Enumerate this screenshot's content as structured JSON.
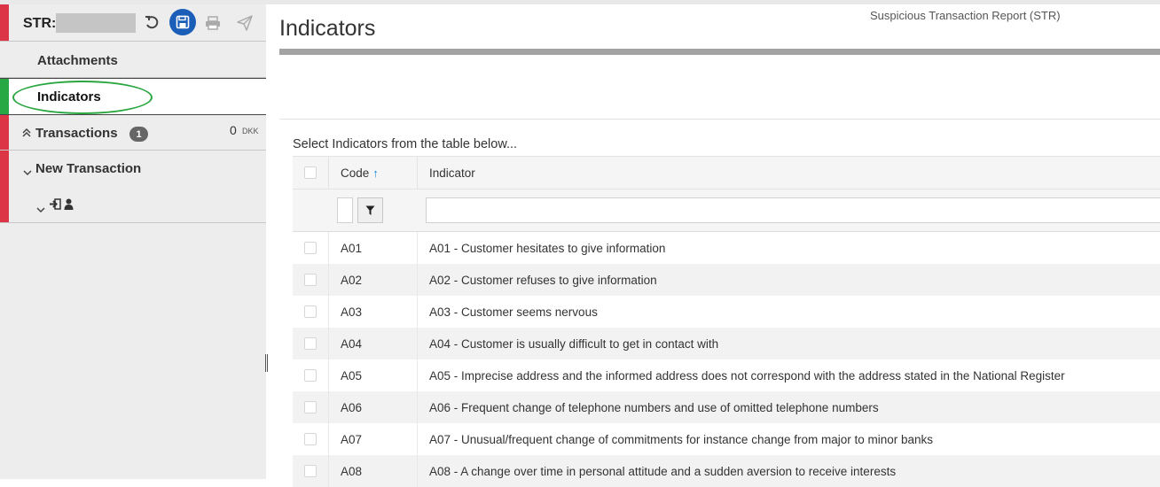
{
  "header": {
    "str_label": "STR:",
    "report_type": "Suspicious Transaction Report (STR)"
  },
  "sidebar": {
    "attachments": "Attachments",
    "indicators": "Indicators",
    "transactions": {
      "label": "Transactions",
      "count": "1",
      "amount": "0",
      "currency": "DKK"
    },
    "new_transaction": "New Transaction"
  },
  "main": {
    "title": "Indicators",
    "instruction": "Select Indicators from the table below...",
    "columns": {
      "code": "Code",
      "indicator": "Indicator"
    },
    "rows": [
      {
        "code": "A01",
        "indicator": "A01 - Customer hesitates to give information"
      },
      {
        "code": "A02",
        "indicator": "A02 - Customer refuses to give information"
      },
      {
        "code": "A03",
        "indicator": "A03 - Customer seems nervous"
      },
      {
        "code": "A04",
        "indicator": "A04 - Customer is usually difficult to get in contact with"
      },
      {
        "code": "A05",
        "indicator": "A05 - Imprecise address and the informed address does not correspond with the address stated in the National Register"
      },
      {
        "code": "A06",
        "indicator": "A06 - Frequent change of telephone numbers and use of omitted telephone numbers"
      },
      {
        "code": "A07",
        "indicator": "A07 - Unusual/frequent change of commitments for instance change from major to minor banks"
      },
      {
        "code": "A08",
        "indicator": "A08 - A change over time in personal attitude and a sudden aversion to receive interests"
      }
    ]
  },
  "colors": {
    "accent_red": "#dc3545",
    "accent_green": "#28a745",
    "save_blue": "#1a5eb8",
    "highlight_ellipse": "#2aa640"
  },
  "icons": [
    "undo-icon",
    "save-icon",
    "print-icon",
    "send-icon",
    "chevron-up-icon",
    "chevron-down-icon",
    "sign-in-icon",
    "user-icon",
    "filter-icon",
    "sort-asc-icon"
  ]
}
